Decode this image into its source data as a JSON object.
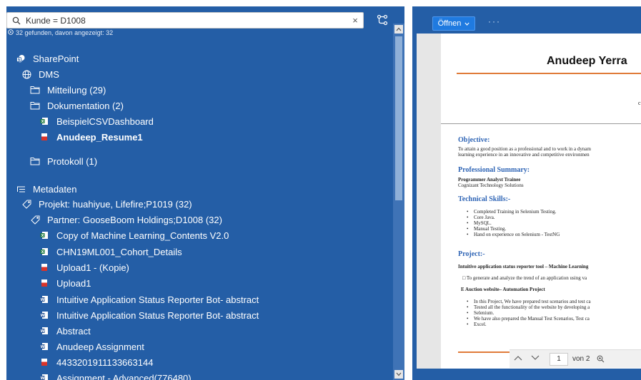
{
  "search": {
    "value": "Kunde = D1008",
    "clear": "×",
    "result_count": "32 gefunden, davon angezeigt: 32"
  },
  "tree": [
    {
      "label": "SharePoint",
      "icon": "sharepoint-icon",
      "indent": 0,
      "bold": false
    },
    {
      "label": "DMS",
      "icon": "globe-icon",
      "indent": 1,
      "bold": false
    },
    {
      "label": "Mitteilung (29)",
      "icon": "folder-icon",
      "indent": 2,
      "bold": false
    },
    {
      "label": "Dokumentation (2)",
      "icon": "folder-icon",
      "indent": 2,
      "bold": false
    },
    {
      "label": "BeispielCSVDashboard",
      "icon": "excel-file-icon",
      "indent": 3,
      "bold": false
    },
    {
      "label": "Anudeep_Resume1",
      "icon": "pdf-file-icon",
      "indent": 3,
      "bold": true
    },
    {
      "label": "Protokoll (1)",
      "icon": "folder-icon",
      "indent": 2,
      "bold": false
    },
    {
      "label": "Metadaten",
      "icon": "metadata-icon",
      "indent": 0,
      "bold": false
    },
    {
      "label": "Projekt: huahiyue, Lifefire;P1019 (32)",
      "icon": "tag-icon",
      "indent": 1,
      "bold": false
    },
    {
      "label": "Partner: GooseBoom Holdings;D1008 (32)",
      "icon": "tag-icon",
      "indent": 2,
      "bold": false
    },
    {
      "label": "Copy of Machine Learning_Contents V2.0",
      "icon": "excel-file-icon",
      "indent": 3,
      "bold": false
    },
    {
      "label": "CHN19ML001_Cohort_Details",
      "icon": "excel-file-icon",
      "indent": 3,
      "bold": false
    },
    {
      "label": "Upload1 - (Kopie)",
      "icon": "pdf-file-icon",
      "indent": 3,
      "bold": false
    },
    {
      "label": "Upload1",
      "icon": "pdf-file-icon",
      "indent": 3,
      "bold": false
    },
    {
      "label": "Intuitive Application Status Reporter Bot- abstract",
      "icon": "word-file-icon",
      "indent": 3,
      "bold": false
    },
    {
      "label": "Intuitive Application Status Reporter Bot- abstract",
      "icon": "word-file-icon",
      "indent": 3,
      "bold": false
    },
    {
      "label": "Abstract",
      "icon": "word-file-icon",
      "indent": 3,
      "bold": false
    },
    {
      "label": "Anudeep Assignment",
      "icon": "word-file-icon",
      "indent": 3,
      "bold": false
    },
    {
      "label": "4433201911133663144",
      "icon": "pdf-file-icon",
      "indent": 3,
      "bold": false
    },
    {
      "label": "Assignment - Advanced(776480)",
      "icon": "word-file-icon",
      "indent": 3,
      "bold": false
    }
  ],
  "viewer": {
    "open_label": "Öffnen",
    "more_label": "···",
    "doc": {
      "name": "Anudeep Yerra",
      "c_letter": "c",
      "objective_h": "Objective:",
      "objective_1": "To attain a good position as a professional and to work in a dynam",
      "objective_2": "learning experience in an innovative and competitive environmen",
      "summary_h": "Professional Summary:",
      "summary_1": "Programmer Analyst Trainee",
      "summary_2": "Cognizant Technology Solutions",
      "skills_h": "Technical Skills:-",
      "skills": [
        "Completed Training in Selenium Testing.",
        "Core Java.",
        "MySQL.",
        "Manual Testing.",
        "Hand on experience on Selenium - TestNG"
      ],
      "project_h": "Project:-",
      "project_1": "Intuitive application status reporter tool – Machine Learning",
      "project_2": "□ To generate and analyze the trend of an application using va",
      "project_3": "E Auction website– Automation Project",
      "project_items": [
        "In this Project, We have prepared test scenarios and test ca",
        "Tested all the functionality of the website by developing a",
        "Selenium.",
        "We have also prepared the Manual Test Scenarios, Test ca",
        "Excel."
      ]
    },
    "pager": {
      "page": "1",
      "of_label": "von 2"
    }
  },
  "colors": {
    "panel": "#245ea6",
    "accent_orange": "#e07b39",
    "heading_blue": "#2e64b5"
  }
}
